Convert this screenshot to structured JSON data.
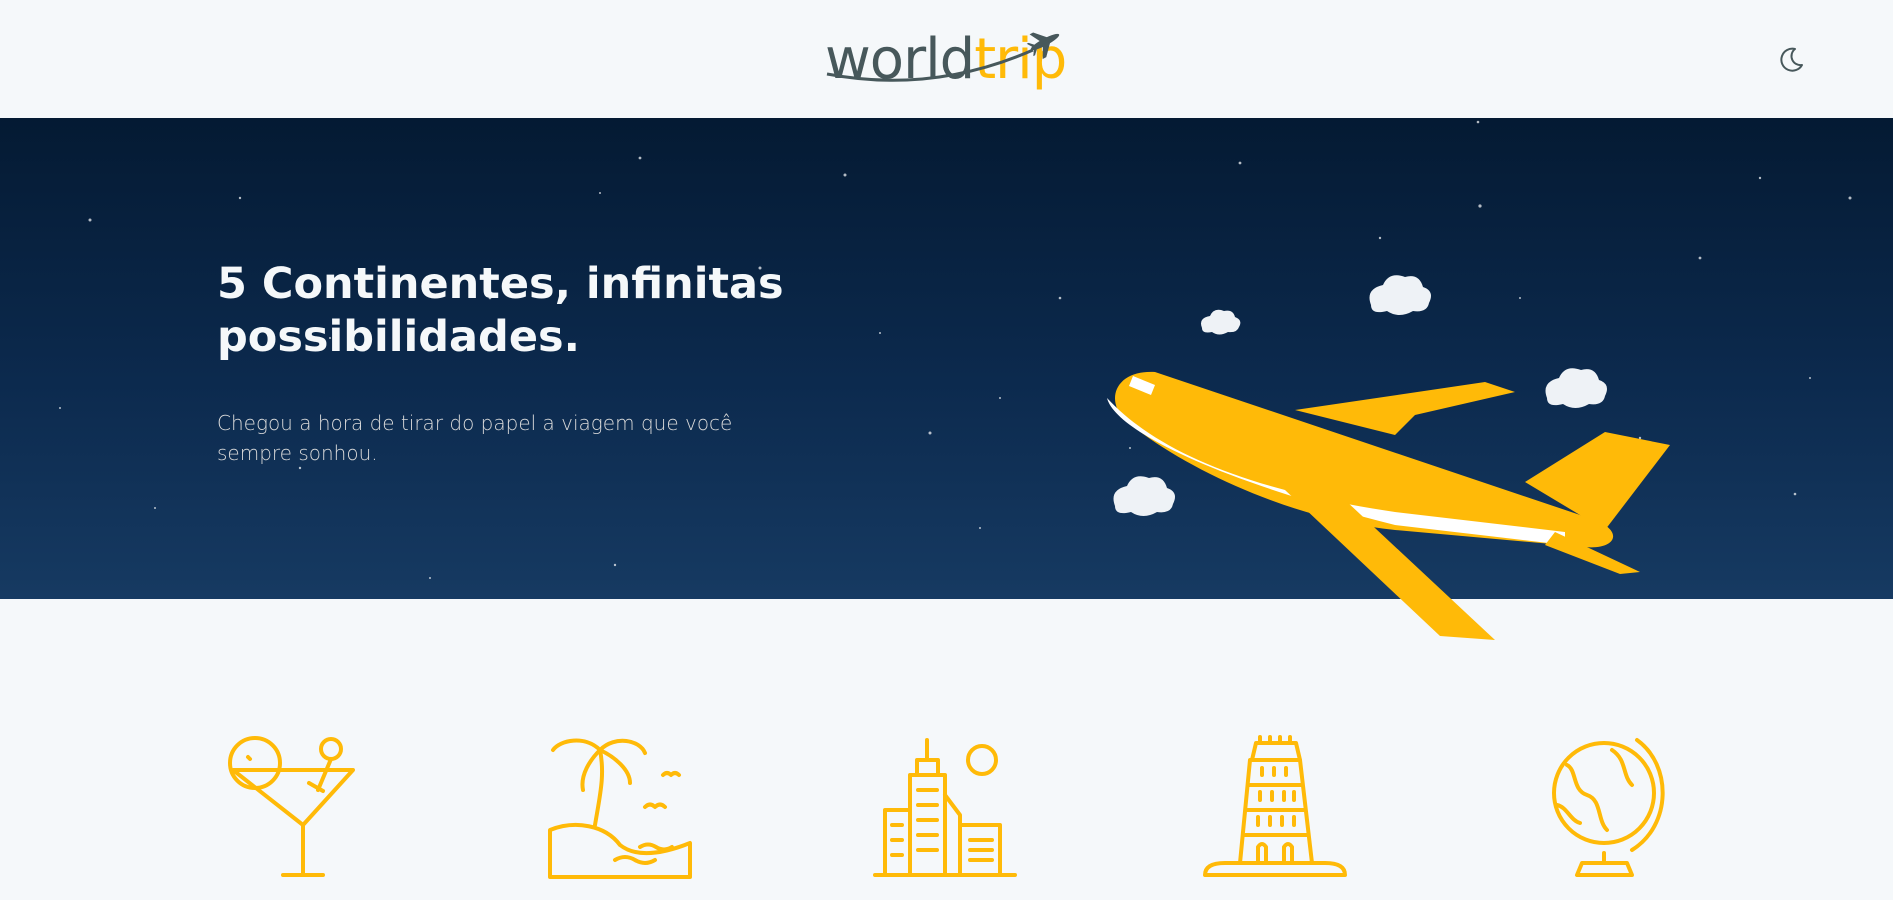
{
  "header": {
    "logo": {
      "word1": "world",
      "word2": "trip"
    },
    "theme_toggle_icon": "moon-icon"
  },
  "hero": {
    "title_line1": "5 Continentes, infinitas",
    "title_line2": "possibilidades.",
    "subtitle_line1": "Chegou a hora de tirar do papel a viagem que você",
    "subtitle_line2": "sempre sonhou.",
    "illustration": "airplane-with-clouds"
  },
  "categories": [
    {
      "icon": "cocktail-icon"
    },
    {
      "icon": "beach-icon"
    },
    {
      "icon": "modern-city-icon"
    },
    {
      "icon": "classic-building-icon"
    },
    {
      "icon": "globe-icon"
    }
  ],
  "colors": {
    "background": "#f5f8fa",
    "hero_dark": "#041a33",
    "accent": "#ffba08",
    "logo_gray": "#47585b",
    "text_light": "#f5f8fa"
  }
}
